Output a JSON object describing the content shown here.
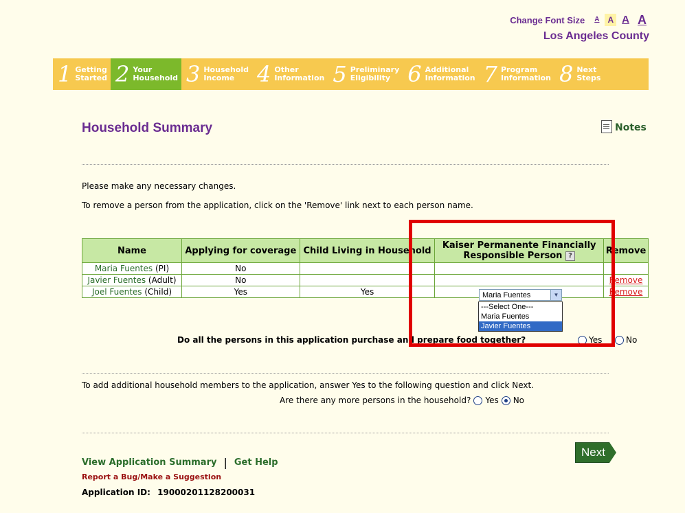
{
  "header": {
    "font_size_label": "Change Font Size",
    "font_sizes": [
      "A",
      "A",
      "A",
      "A"
    ],
    "county": "Los Angeles County"
  },
  "steps": [
    {
      "num": "1",
      "label": "Getting\nStarted",
      "active": false
    },
    {
      "num": "2",
      "label": "Your\nHousehold",
      "active": true
    },
    {
      "num": "3",
      "label": "Household\nIncome",
      "active": false
    },
    {
      "num": "4",
      "label": "Other\nInformation",
      "active": false
    },
    {
      "num": "5",
      "label": "Preliminary\nEligibility",
      "active": false
    },
    {
      "num": "6",
      "label": "Additional\nInformation",
      "active": false
    },
    {
      "num": "7",
      "label": "Program\nInformation",
      "active": false
    },
    {
      "num": "8",
      "label": "Next\nSteps",
      "active": false
    }
  ],
  "page": {
    "title": "Household Summary",
    "notes_label": "Notes",
    "intro1": "Please make any necessary changes.",
    "intro2": "To remove a person from the application, click on the 'Remove' link next to each person name."
  },
  "table": {
    "headers": {
      "name": "Name",
      "applying": "Applying for coverage",
      "child": "Child Living in Household",
      "kaiser": "Kaiser Permanente Financially Responsible Person",
      "remove": "Remove"
    },
    "help_glyph": "?",
    "rows": [
      {
        "name": "Maria Fuentes",
        "role": "(PI)",
        "applying": "No",
        "child": "",
        "remove": ""
      },
      {
        "name": "Javier Fuentes",
        "role": "(Adult)",
        "applying": "No",
        "child": "",
        "remove": "Remove"
      },
      {
        "name": "Joel Fuentes",
        "role": "(Child)",
        "applying": "Yes",
        "child": "Yes",
        "remove": "Remove"
      }
    ]
  },
  "dropdown": {
    "selected": "Maria Fuentes",
    "options": [
      "---Select One---",
      "Maria Fuentes",
      "Javier Fuentes"
    ],
    "highlighted": "Javier Fuentes"
  },
  "food_question": {
    "text": "Do all the persons in this application purchase and prepare food together?",
    "yes": "Yes",
    "no": "No"
  },
  "add_members": {
    "intro": "To add additional household members to the application, answer Yes to the following question and click Next.",
    "question": "Are there any more persons in the household?",
    "yes": "Yes",
    "no": "No",
    "selected": "No"
  },
  "footer": {
    "next": "Next",
    "view_summary": "View Application Summary",
    "separator": "|",
    "get_help": "Get Help",
    "report_bug": "Report a Bug/Make a Suggestion",
    "app_id_label": "Application ID:",
    "app_id_value": "19000201128200031"
  },
  "colors": {
    "brand_purple": "#6a2c91",
    "stepbar": "#f7c94f",
    "active_step": "#7cb92b",
    "highlight_box": "#e00000"
  }
}
